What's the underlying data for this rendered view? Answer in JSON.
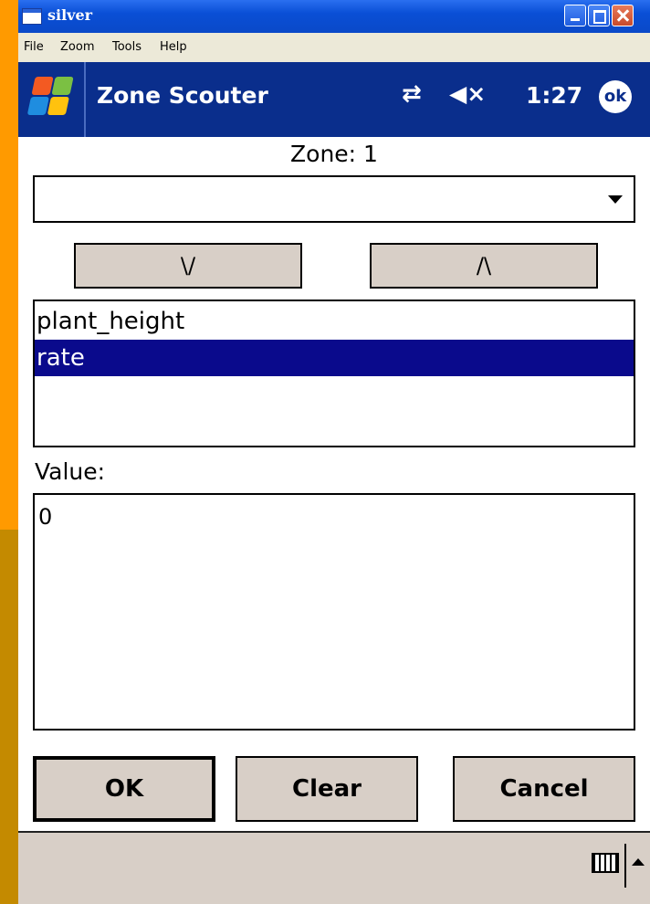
{
  "window": {
    "title": "silver"
  },
  "menu": {
    "items": [
      "File",
      "Zoom",
      "Tools",
      "Help"
    ]
  },
  "appbar": {
    "title": "Zone Scouter",
    "time": "1:27",
    "ok_label": "ok",
    "connectivity_icon": "connection-arrows-icon",
    "volume_icon": "volume-muted-icon"
  },
  "form": {
    "zone_label": "Zone: 1",
    "combo_value": "",
    "down_label": "\\/",
    "up_label": "/\\",
    "list_items": [
      "plant_height",
      "rate"
    ],
    "selected_index": 1,
    "value_label": "Value:",
    "value_text": "0"
  },
  "buttons": {
    "ok": "OK",
    "clear": "Clear",
    "cancel": "Cancel"
  },
  "colors": {
    "appbar": "#0a2e8c",
    "selection": "#0a0a8c",
    "button_face": "#d8cfc7",
    "left_strip": "#ff9a00"
  }
}
